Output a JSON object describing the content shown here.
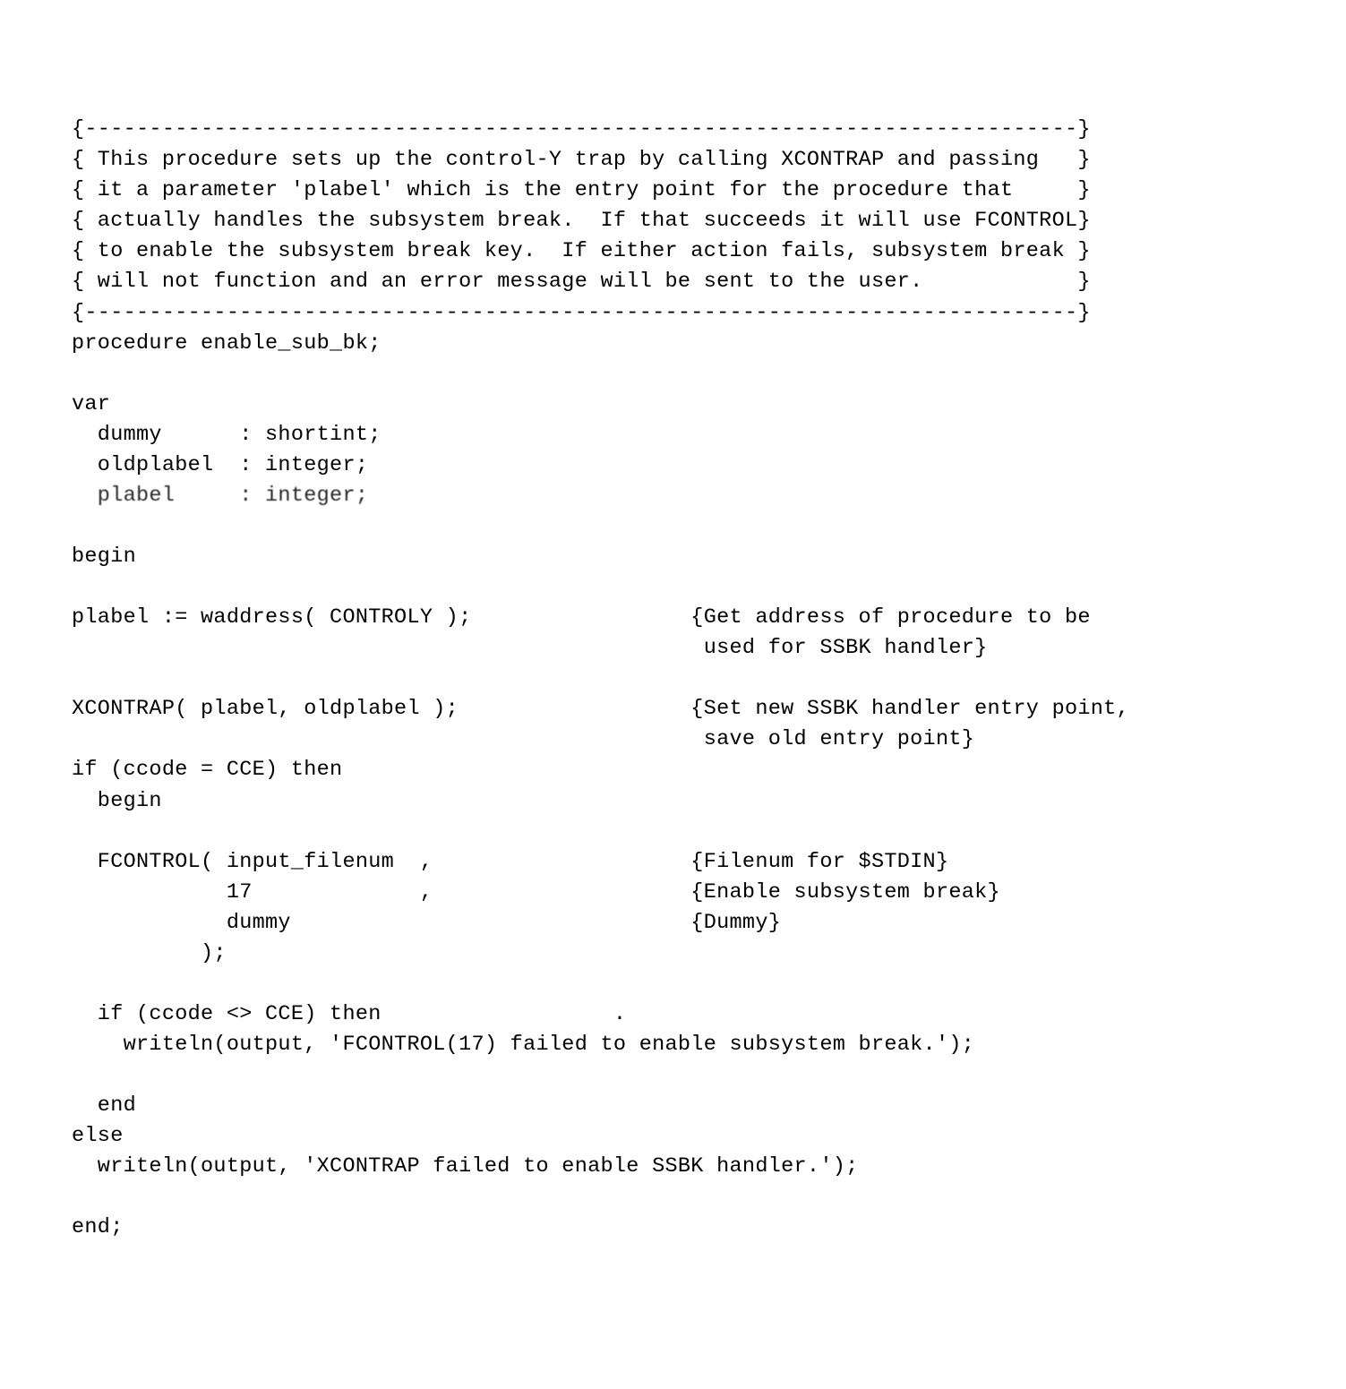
{
  "lines": [
    "{-----------------------------------------------------------------------------}",
    "{ This procedure sets up the control-Y trap by calling XCONTRAP and passing   }",
    "{ it a parameter 'plabel' which is the entry point for the procedure that     }",
    "{ actually handles the subsystem break.  If that succeeds it will use FCONTROL}",
    "{ to enable the subsystem break key.  If either action fails, subsystem break }",
    "{ will not function and an error message will be sent to the user.            }",
    "{-----------------------------------------------------------------------------}",
    "procedure enable_sub_bk;",
    "",
    "var",
    "  dummy      : shortint;",
    "  oldplabel  : integer;",
    "  plabel     : integer;",
    "",
    "begin",
    "",
    "plabel := waddress( CONTROLY );                 {Get address of procedure to be",
    "                                                 used for SSBK handler}",
    "",
    "XCONTRAP( plabel, oldplabel );                  {Set new SSBK handler entry point,",
    "                                                 save old entry point}",
    "if (ccode = CCE) then",
    "  begin",
    "",
    "  FCONTROL( input_filenum  ,                    {Filenum for $STDIN}",
    "            17             ,                    {Enable subsystem break}",
    "            dummy                               {Dummy}",
    "          );",
    "",
    "  if (ccode <> CCE) then                  .",
    "    writeln(output, 'FCONTROL(17) failed to enable subsystem break.');",
    "",
    "  end",
    "else",
    "  writeln(output, 'XCONTRAP failed to enable SSBK handler.');",
    "",
    "end;"
  ],
  "fuzzy_index": 12
}
